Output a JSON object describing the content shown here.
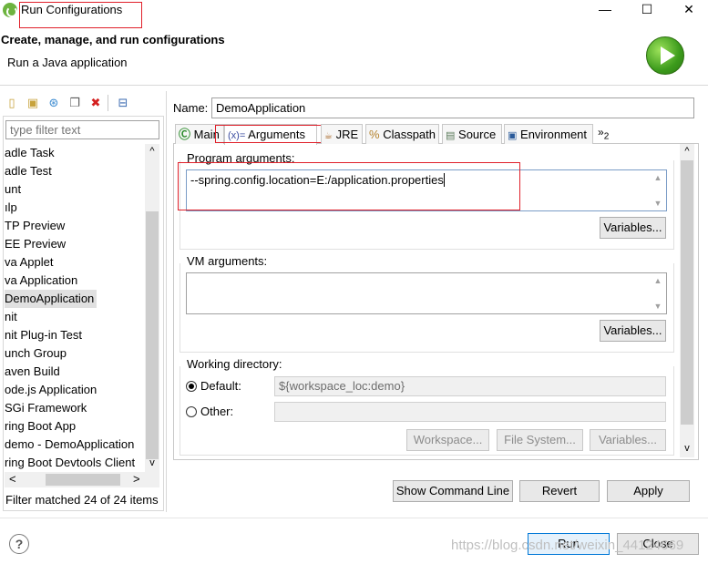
{
  "window": {
    "title": "Run Configurations",
    "minimize": "—",
    "maximize": "☐",
    "close": "✕"
  },
  "header": {
    "title": "Create, manage, and run configurations",
    "subtitle": "Run a Java application"
  },
  "sidebar": {
    "filter_placeholder": "type filter text",
    "items": [
      "adle Task",
      "adle Test",
      "unt",
      "ılp",
      "TP Preview",
      "EE Preview",
      "va Applet",
      "va Application",
      "DemoApplication",
      "nit",
      "nit Plug-in Test",
      "unch Group",
      "aven Build",
      "ode.js Application",
      "SGi Framework",
      "ring Boot App",
      "demo - DemoApplication",
      "ring Boot Devtools Client"
    ],
    "status": "Filter matched 24 of 24 items",
    "arrow_left": "<",
    "arrow_right": ">",
    "arrow_up": "^",
    "arrow_down": "v"
  },
  "config": {
    "name_label": "Name:",
    "name_value": "DemoApplication",
    "tabs": [
      {
        "icon": "C",
        "label": "Main"
      },
      {
        "icon": "(x)=",
        "label": "Arguments"
      },
      {
        "icon": "JRE",
        "label": "JRE"
      },
      {
        "icon": "%",
        "label": "Classpath"
      },
      {
        "icon": "src",
        "label": "Source"
      },
      {
        "icon": "env",
        "label": "Environment"
      },
      {
        "icon": "»",
        "label": "2"
      }
    ],
    "program_args_label": "Program arguments:",
    "program_args_value": "--spring.config.location=E:/application.properties",
    "vm_args_label": "VM arguments:",
    "vm_args_value": "",
    "variables_label": "Variables...",
    "working_dir_label": "Working directory:",
    "default_label": "Default:",
    "default_value": "${workspace_loc:demo}",
    "other_label": "Other:",
    "workspace_btn": "Workspace...",
    "filesystem_btn": "File System...",
    "variables_btn": "Variables..."
  },
  "actions": {
    "show_command_line": "Show Command Line",
    "revert": "Revert",
    "apply": "Apply",
    "run": "Run",
    "close": "Close",
    "help": "?"
  },
  "watermark": "https://blog.csdn.net/weixin_44124669",
  "colors": {
    "highlight_red": "#e0202a",
    "focus_blue": "#0078d7",
    "run_green": "#3c9b1c"
  }
}
